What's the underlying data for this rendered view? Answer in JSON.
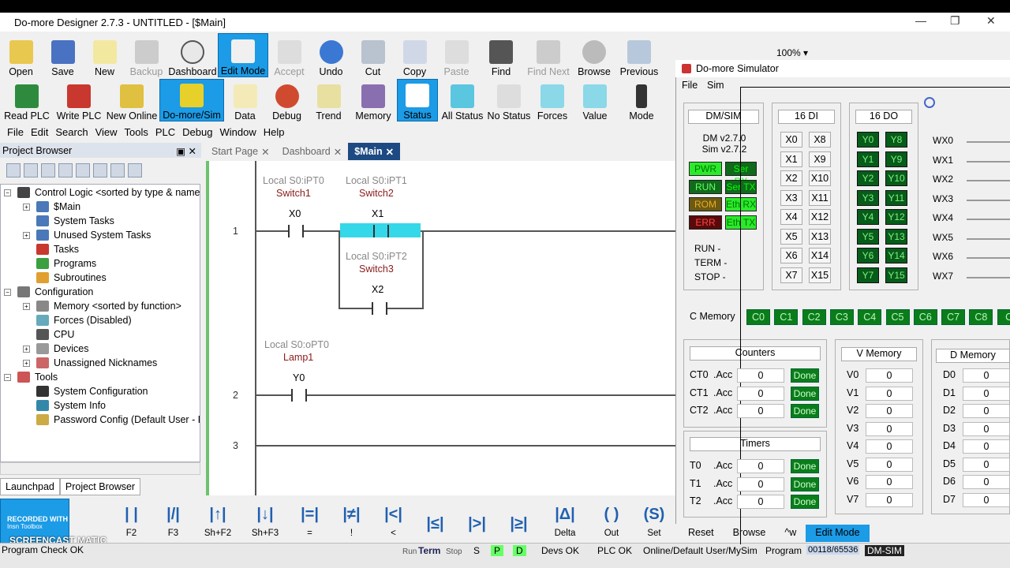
{
  "title": "Do-more Designer 2.7.3 - UNTITLED - [$Main]",
  "ribbon1": [
    "Open",
    "Save",
    "New",
    "Backup",
    "Dashboard",
    "Edit Mode",
    "Accept",
    "Undo",
    "Cut",
    "Copy",
    "Paste",
    "Find",
    "Find Next",
    "Browse",
    "Previous"
  ],
  "zoom": "100%",
  "ribbon2": [
    "Read PLC",
    "Write PLC",
    "New Online",
    "Do-more/Sim",
    "Data",
    "Debug",
    "Trend",
    "Memory",
    "Status",
    "All Status",
    "No Status",
    "Forces",
    "Value",
    "Mode"
  ],
  "menu": [
    "File",
    "Edit",
    "Search",
    "View",
    "Tools",
    "PLC",
    "Debug",
    "Window",
    "Help"
  ],
  "project_browser": "Project Browser",
  "tree": [
    {
      "label": "Control Logic <sorted by type & name>"
    },
    {
      "label": "$Main"
    },
    {
      "label": "System Tasks"
    },
    {
      "label": "Unused System Tasks"
    },
    {
      "label": "Tasks"
    },
    {
      "label": "Programs"
    },
    {
      "label": "Subroutines"
    },
    {
      "label": "Configuration"
    },
    {
      "label": "Memory <sorted by function>"
    },
    {
      "label": "Forces (Disabled)"
    },
    {
      "label": "CPU"
    },
    {
      "label": "Devices"
    },
    {
      "label": "Unassigned Nicknames"
    },
    {
      "label": "Tools"
    },
    {
      "label": "System Configuration"
    },
    {
      "label": "System Info"
    },
    {
      "label": "Password Config (Default User - R"
    }
  ],
  "bottom_tabs": [
    "Launchpad",
    "Project Browser"
  ],
  "doc_tabs": [
    "Start Page",
    "Dashboard",
    "$Main"
  ],
  "ladder": {
    "r1": "1",
    "r2": "2",
    "r3": "3",
    "x0_lbl": "Local S0:iPT0",
    "x0_nick": "Switch1",
    "x0": "X0",
    "x1_lbl": "Local S0:iPT1",
    "x1_nick": "Switch2",
    "x1": "X1",
    "x2_lbl": "Local S0:iPT2",
    "x2_nick": "Switch3",
    "x2": "X2",
    "y0_lbl": "Local S0:oPT0",
    "y0_nick": "Lamp1",
    "y0": "Y0"
  },
  "bottom_tools": [
    "F2",
    "F3",
    "Sh+F2",
    "Sh+F3",
    "=",
    "!",
    "<",
    "",
    "",
    "",
    "Delta",
    "Out",
    "Set",
    "Reset",
    "Browse",
    "^w",
    "Edit Mode"
  ],
  "status": {
    "run": "Run",
    "term": "Term",
    "stop": "Stop",
    "s": "S",
    "p": "P",
    "d": "D",
    "devs": "Devs OK",
    "plc": "PLC OK",
    "user": "Online/Default User/MySim",
    "program": "Program",
    "mem": "00118/65536",
    "dm": "DM-SIM",
    "check": "Program Check OK"
  },
  "screencast": {
    "l1": "RECORDED WITH",
    "l2": "SCREENCAST",
    "l3": "MATIC",
    "l4": "Insn Toolbox"
  },
  "sim": {
    "title": "Do-more Simulator",
    "menu": [
      "File",
      "Sim"
    ],
    "dmsim": "DM/SIM",
    "ver1": "DM v2.7.0",
    "ver2": "Sim v2.7.2",
    "leds": [
      "PWR",
      "Ser RX",
      "RUN",
      "Ser TX",
      "ROM",
      "Eth RX",
      "ERR",
      "Eth TX"
    ],
    "modes": [
      "RUN -",
      "TERM -",
      "STOP -"
    ],
    "di_head": "16 DI",
    "di": [
      "X0",
      "X8",
      "X1",
      "X9",
      "X2",
      "X10",
      "X3",
      "X11",
      "X4",
      "X12",
      "X5",
      "X13",
      "X6",
      "X14",
      "X7",
      "X15"
    ],
    "do_head": "16 DO",
    "do": [
      "Y0",
      "Y8",
      "Y1",
      "Y9",
      "Y2",
      "Y10",
      "Y3",
      "Y11",
      "Y4",
      "Y12",
      "Y5",
      "Y13",
      "Y6",
      "Y14",
      "Y7",
      "Y15"
    ],
    "wx": [
      "WX0",
      "WX1",
      "WX2",
      "WX3",
      "WX4",
      "WX5",
      "WX6",
      "WX7"
    ],
    "cmem": "C Memory",
    "cbits": [
      "C0",
      "C1",
      "C2",
      "C3",
      "C4",
      "C5",
      "C6",
      "C7",
      "C8",
      "C"
    ],
    "counters": "Counters",
    "ct": [
      {
        "n": "CT0",
        "a": ".Acc",
        "v": "0",
        "d": "Done"
      },
      {
        "n": "CT1",
        "a": ".Acc",
        "v": "0",
        "d": "Done"
      },
      {
        "n": "CT2",
        "a": ".Acc",
        "v": "0",
        "d": "Done"
      }
    ],
    "timers": "Timers",
    "t": [
      {
        "n": "T0",
        "a": ".Acc",
        "v": "0",
        "d": "Done"
      },
      {
        "n": "T1",
        "a": ".Acc",
        "v": "0",
        "d": "Done"
      },
      {
        "n": "T2",
        "a": ".Acc",
        "v": "0",
        "d": "Done"
      }
    ],
    "vmem": "V Memory",
    "v": [
      {
        "n": "V0",
        "v": "0"
      },
      {
        "n": "V1",
        "v": "0"
      },
      {
        "n": "V2",
        "v": "0"
      },
      {
        "n": "V3",
        "v": "0"
      },
      {
        "n": "V4",
        "v": "0"
      },
      {
        "n": "V5",
        "v": "0"
      },
      {
        "n": "V6",
        "v": "0"
      },
      {
        "n": "V7",
        "v": "0"
      }
    ],
    "dmem": "D Memory",
    "d": [
      {
        "n": "D0",
        "v": "0"
      },
      {
        "n": "D1",
        "v": "0"
      },
      {
        "n": "D2",
        "v": "0"
      },
      {
        "n": "D3",
        "v": "0"
      },
      {
        "n": "D4",
        "v": "0"
      },
      {
        "n": "D5",
        "v": "0"
      },
      {
        "n": "D6",
        "v": "0"
      },
      {
        "n": "D7",
        "v": "0"
      }
    ]
  }
}
